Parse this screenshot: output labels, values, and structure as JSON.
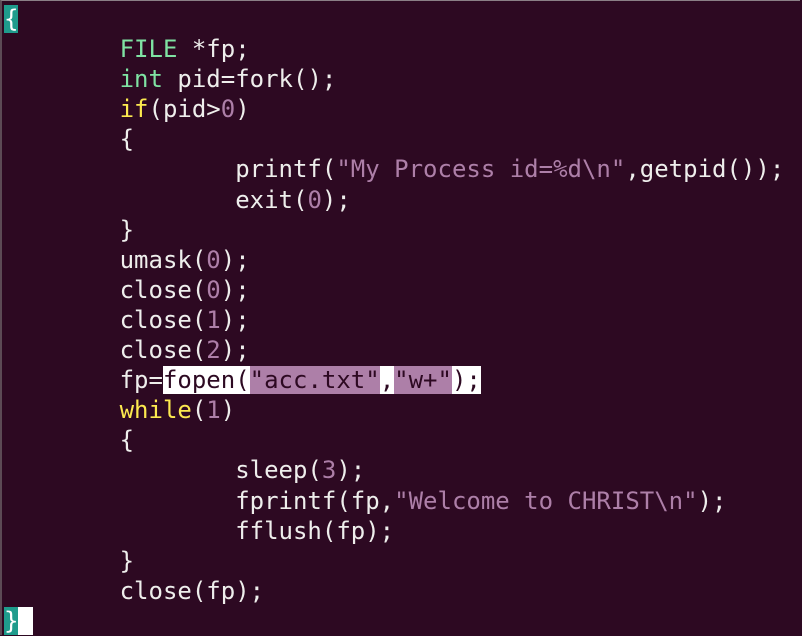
{
  "editor": {
    "colors": {
      "background": "#2d0922",
      "type": "#7fe3a3",
      "keyword": "#fce94f",
      "string": "#ad7fa8",
      "cursor": "#1f9b8c"
    },
    "lines": [
      [
        {
          "t": "cur",
          "v": "{"
        }
      ],
      [
        {
          "t": "n",
          "v": "        "
        },
        {
          "t": "type",
          "v": "FILE"
        },
        {
          "t": "n",
          "v": " *fp;"
        }
      ],
      [
        {
          "t": "n",
          "v": "        "
        },
        {
          "t": "type",
          "v": "int"
        },
        {
          "t": "n",
          "v": " pid=fork();"
        }
      ],
      [
        {
          "t": "n",
          "v": "        "
        },
        {
          "t": "kw",
          "v": "if"
        },
        {
          "t": "n",
          "v": "(pid>"
        },
        {
          "t": "num",
          "v": "0"
        },
        {
          "t": "n",
          "v": ")"
        }
      ],
      [
        {
          "t": "n",
          "v": "        {"
        }
      ],
      [
        {
          "t": "n",
          "v": "                printf("
        },
        {
          "t": "str",
          "v": "\"My Process id=%d\\n\""
        },
        {
          "t": "n",
          "v": ",getpid());"
        }
      ],
      [
        {
          "t": "n",
          "v": "                exit("
        },
        {
          "t": "num",
          "v": "0"
        },
        {
          "t": "n",
          "v": ");"
        }
      ],
      [
        {
          "t": "n",
          "v": "        }"
        }
      ],
      [
        {
          "t": "n",
          "v": "        umask("
        },
        {
          "t": "num",
          "v": "0"
        },
        {
          "t": "n",
          "v": ");"
        }
      ],
      [
        {
          "t": "n",
          "v": "        close("
        },
        {
          "t": "num",
          "v": "0"
        },
        {
          "t": "n",
          "v": ");"
        }
      ],
      [
        {
          "t": "n",
          "v": "        close("
        },
        {
          "t": "num",
          "v": "1"
        },
        {
          "t": "n",
          "v": ");"
        }
      ],
      [
        {
          "t": "n",
          "v": "        close("
        },
        {
          "t": "num",
          "v": "2"
        },
        {
          "t": "n",
          "v": ");"
        }
      ],
      [
        {
          "t": "n",
          "v": "        fp="
        },
        {
          "t": "sel",
          "v": "fopen("
        },
        {
          "t": "selstr",
          "v": "\"acc.txt\""
        },
        {
          "t": "sel",
          "v": ","
        },
        {
          "t": "selstr",
          "v": "\"w+\""
        },
        {
          "t": "sel",
          "v": ");"
        }
      ],
      [
        {
          "t": "n",
          "v": "        "
        },
        {
          "t": "kw",
          "v": "while"
        },
        {
          "t": "n",
          "v": "("
        },
        {
          "t": "num",
          "v": "1"
        },
        {
          "t": "n",
          "v": ")"
        }
      ],
      [
        {
          "t": "n",
          "v": "        {"
        }
      ],
      [
        {
          "t": "n",
          "v": "                sleep("
        },
        {
          "t": "num",
          "v": "3"
        },
        {
          "t": "n",
          "v": ");"
        }
      ],
      [
        {
          "t": "n",
          "v": "                fprintf(fp,"
        },
        {
          "t": "str",
          "v": "\"Welcome to CHRIST\\n\""
        },
        {
          "t": "n",
          "v": ");"
        }
      ],
      [
        {
          "t": "n",
          "v": "                fflush(fp);"
        }
      ],
      [
        {
          "t": "n",
          "v": "        }"
        }
      ],
      [
        {
          "t": "n",
          "v": "        close(fp);"
        }
      ],
      [
        {
          "t": "cur",
          "v": "}"
        },
        {
          "t": "blk",
          "v": " "
        }
      ]
    ]
  }
}
